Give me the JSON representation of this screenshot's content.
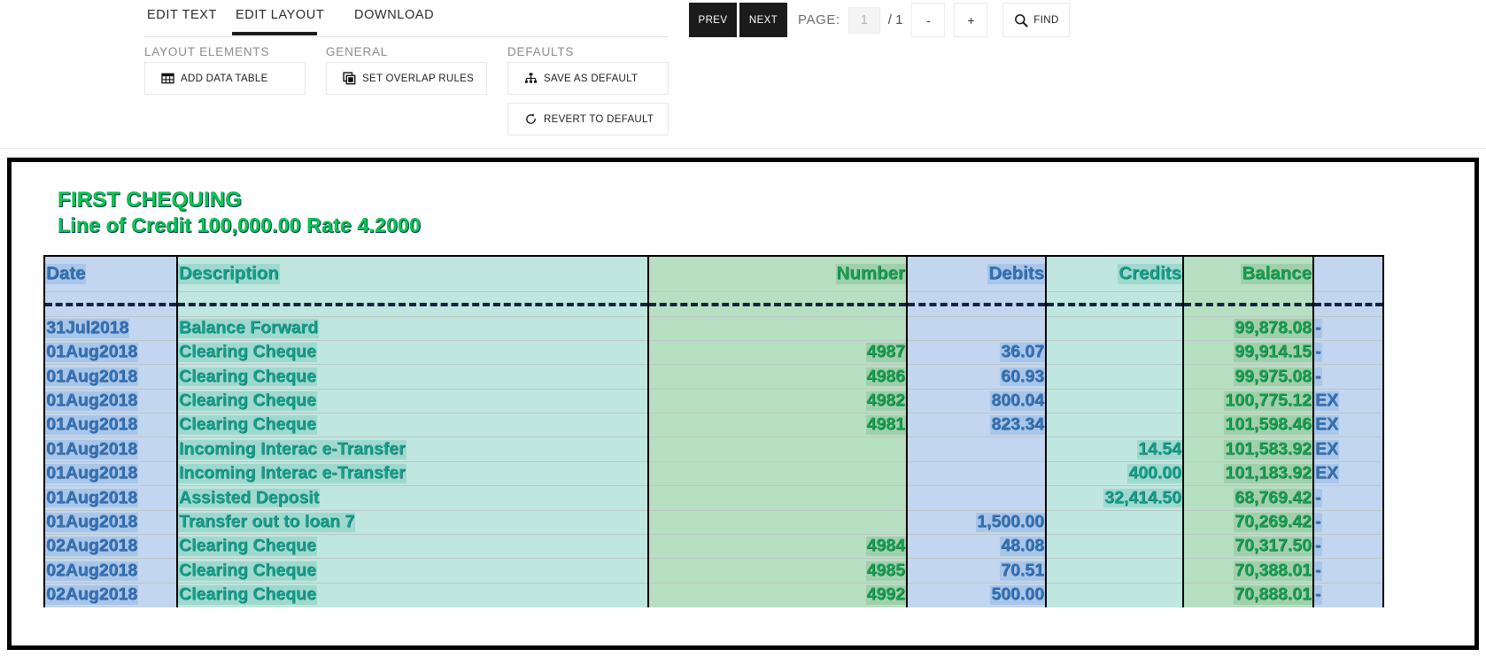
{
  "tabs": [
    {
      "label": "EDIT TEXT",
      "active": false
    },
    {
      "label": "EDIT LAYOUT",
      "active": true
    },
    {
      "label": "DOWNLOAD",
      "active": false
    }
  ],
  "groups": {
    "layout_elements": "LAYOUT ELEMENTS",
    "general": "GENERAL",
    "defaults": "DEFAULTS"
  },
  "buttons": {
    "add_data_table": "ADD DATA TABLE",
    "set_overlap_rules": "SET OVERLAP RULES",
    "save_as_default": "SAVE AS DEFAULT",
    "revert_to_default": "REVERT TO DEFAULT",
    "find": "FIND"
  },
  "pager": {
    "prev": "PREV",
    "next": "NEXT",
    "page_label": "PAGE:",
    "page_value": "1",
    "page_total": "/ 1",
    "zoom_out": "-",
    "zoom_in": "+"
  },
  "colors": {
    "accent_dark": "#1b1b1b",
    "title_green": "#06c755",
    "col_blue": "#c3d6ef",
    "col_teal": "#bfe6df",
    "col_green": "#b7dfc1"
  },
  "document": {
    "title_line1": "FIRST CHEQUING",
    "title_line2": "Line of Credit 100,000.00 Rate 4.2000",
    "columns": [
      "Date",
      "Description",
      "Number",
      "Debits",
      "Credits",
      "Balance",
      ""
    ],
    "rows": [
      {
        "date": "",
        "description": "",
        "number": "",
        "debits": "",
        "credits": "",
        "balance": "",
        "flag": "",
        "dashed": true
      },
      {
        "date": "31Jul2018",
        "description": "Balance Forward",
        "number": "",
        "debits": "",
        "credits": "",
        "balance": "99,878.08",
        "flag": "-"
      },
      {
        "date": "01Aug2018",
        "description": "Clearing Cheque",
        "number": "4987",
        "debits": "36.07",
        "credits": "",
        "balance": "99,914.15",
        "flag": "-"
      },
      {
        "date": "01Aug2018",
        "description": "Clearing Cheque",
        "number": "4986",
        "debits": "60.93",
        "credits": "",
        "balance": "99,975.08",
        "flag": "-"
      },
      {
        "date": "01Aug2018",
        "description": "Clearing Cheque",
        "number": "4982",
        "debits": "800.04",
        "credits": "",
        "balance": "100,775.12",
        "flag": "EX"
      },
      {
        "date": "01Aug2018",
        "description": "Clearing Cheque",
        "number": "4981",
        "debits": "823.34",
        "credits": "",
        "balance": "101,598.46",
        "flag": "EX"
      },
      {
        "date": "01Aug2018",
        "description": "Incoming Interac e-Transfer",
        "number": "",
        "debits": "",
        "credits": "14.54",
        "balance": "101,583.92",
        "flag": "EX"
      },
      {
        "date": "01Aug2018",
        "description": "Incoming Interac e-Transfer",
        "number": "",
        "debits": "",
        "credits": "400.00",
        "balance": "101,183.92",
        "flag": "EX"
      },
      {
        "date": "01Aug2018",
        "description": "Assisted Deposit",
        "number": "",
        "debits": "",
        "credits": "32,414.50",
        "balance": "68,769.42",
        "flag": "-"
      },
      {
        "date": "01Aug2018",
        "description": "Transfer out  to loan 7",
        "number": "",
        "debits": "1,500.00",
        "credits": "",
        "balance": "70,269.42",
        "flag": "-"
      },
      {
        "date": "02Aug2018",
        "description": "Clearing Cheque",
        "number": "4984",
        "debits": "48.08",
        "credits": "",
        "balance": "70,317.50",
        "flag": "-"
      },
      {
        "date": "02Aug2018",
        "description": "Clearing Cheque",
        "number": "4985",
        "debits": "70.51",
        "credits": "",
        "balance": "70,388.01",
        "flag": "-"
      },
      {
        "date": "02Aug2018",
        "description": "Clearing Cheque",
        "number": "4992",
        "debits": "500.00",
        "credits": "",
        "balance": "70,888.01",
        "flag": "-"
      }
    ]
  }
}
